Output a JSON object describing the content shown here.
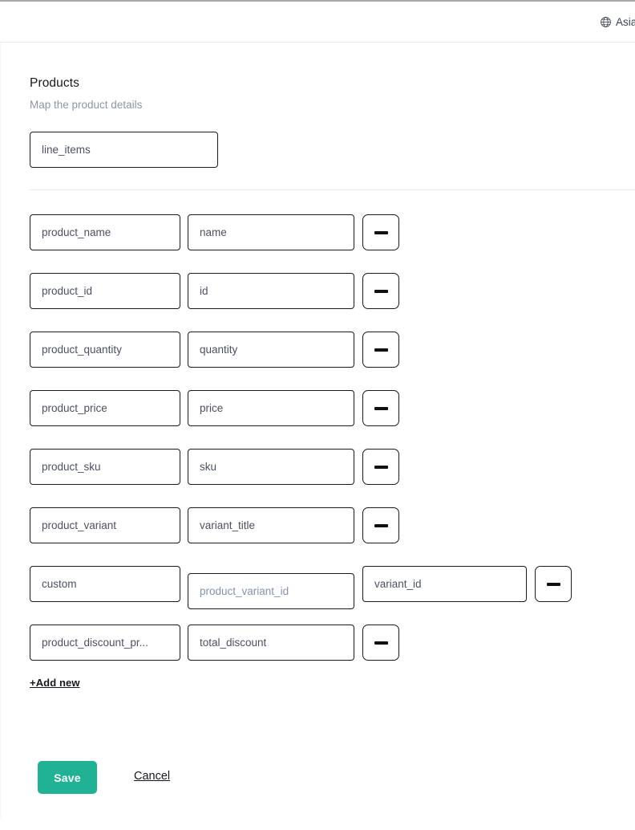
{
  "header": {
    "timezone_label": "Asia/",
    "globe_icon": "globe-icon"
  },
  "section": {
    "title": "Products",
    "subtitle": "Map the product details"
  },
  "root_field": {
    "value": "line_items",
    "placeholder": "line_items"
  },
  "mappings": [
    {
      "source": "product_name",
      "source_is_placeholder": false,
      "target": "name",
      "target_is_placeholder": false,
      "extra": null,
      "extra_is_placeholder": false,
      "remove_label": "remove-row"
    },
    {
      "source": "product_id",
      "source_is_placeholder": false,
      "target": "id",
      "target_is_placeholder": false,
      "extra": null,
      "extra_is_placeholder": false,
      "remove_label": "remove-row"
    },
    {
      "source": "product_quantity",
      "source_is_placeholder": false,
      "target": "quantity",
      "target_is_placeholder": false,
      "extra": null,
      "extra_is_placeholder": false,
      "remove_label": "remove-row"
    },
    {
      "source": "product_price",
      "source_is_placeholder": false,
      "target": "price",
      "target_is_placeholder": false,
      "extra": null,
      "extra_is_placeholder": false,
      "remove_label": "remove-row"
    },
    {
      "source": "product_sku",
      "source_is_placeholder": false,
      "target": "sku",
      "target_is_placeholder": false,
      "extra": null,
      "extra_is_placeholder": false,
      "remove_label": "remove-row"
    },
    {
      "source": "product_variant",
      "source_is_placeholder": false,
      "target": "variant_title",
      "target_is_placeholder": false,
      "extra": null,
      "extra_is_placeholder": false,
      "remove_label": "remove-row"
    },
    {
      "source": "custom",
      "source_is_placeholder": false,
      "target": "product_variant_id",
      "target_is_placeholder": true,
      "extra": "variant_id",
      "extra_is_placeholder": false,
      "remove_label": "remove-row"
    },
    {
      "source": "product_discount_pr...",
      "source_is_placeholder": false,
      "target": "total_discount",
      "target_is_placeholder": false,
      "extra": null,
      "extra_is_placeholder": false,
      "remove_label": "remove-row"
    }
  ],
  "add_new_label": "+Add new",
  "actions": {
    "save_label": "Save",
    "cancel_label": "Cancel"
  },
  "colors": {
    "accent": "#21b195",
    "text": "#16181d",
    "muted": "#8e96a3",
    "field_text": "#4b5160",
    "placeholder": "#8293ab",
    "border": "#1a1a1a",
    "divider": "#e7eaee",
    "page_bg": "#eef1f5"
  }
}
